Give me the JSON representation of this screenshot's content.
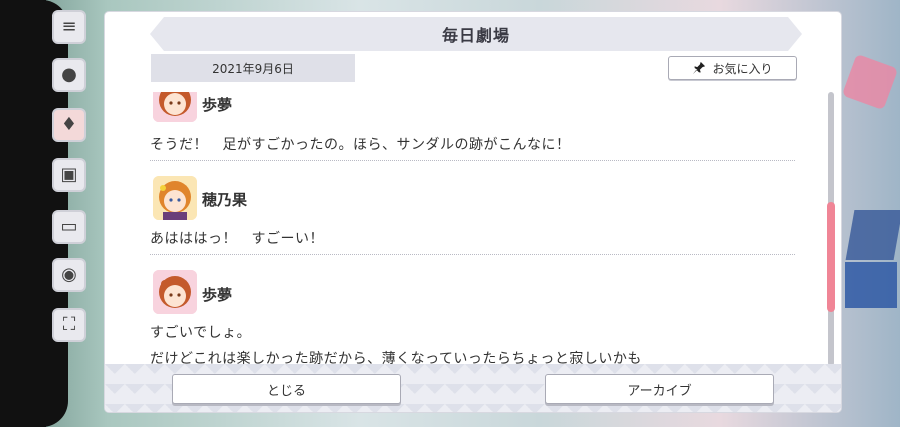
{
  "dialog": {
    "title": "毎日劇場",
    "date": "2021年9月6日",
    "favorite_label": "お気に入り",
    "close_label": "とじる",
    "archive_label": "アーカイブ"
  },
  "entries": [
    {
      "speaker": "歩夢",
      "lines": [
        "そうだ！　足がすごかったの。ほら、サンダルの跡がこんなに！"
      ]
    },
    {
      "speaker": "穂乃果",
      "lines": [
        "あはははっ！　すごーい！"
      ]
    },
    {
      "speaker": "歩夢",
      "lines": [
        "すごいでしょ。",
        "だけどこれは楽しかった跡だから、薄くなっていったらちょっと寂しいかも"
      ]
    }
  ],
  "colors": {
    "accent": "#f08596",
    "title_bar": "#e6e7ee"
  },
  "icons": {
    "menu": "hamburger-icon",
    "favorite": "pin-icon"
  }
}
